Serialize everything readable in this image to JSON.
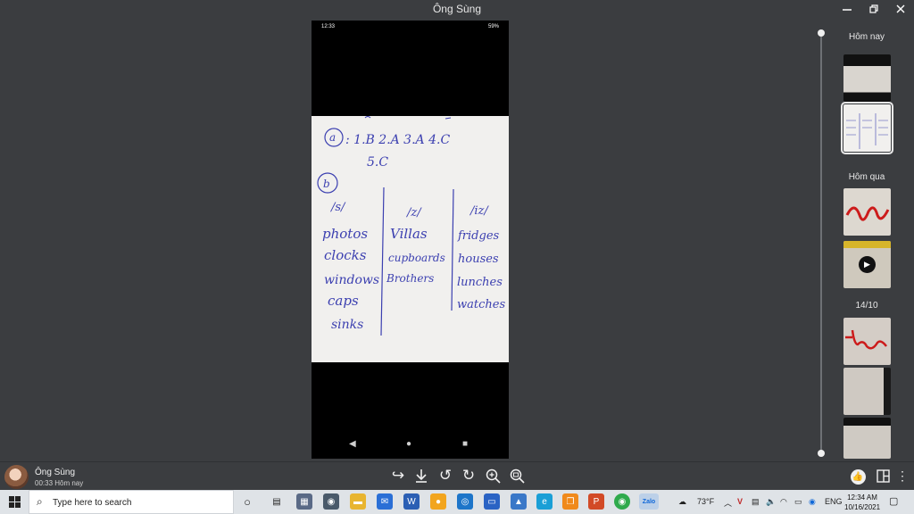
{
  "window": {
    "title": "Ông Sùng"
  },
  "phone": {
    "status_time": "12:33",
    "status_battery": "59%"
  },
  "note": {
    "part_a_marker": "a",
    "part_a_line1": ": 1.B   2.A  3.A  4.C",
    "part_a_line2": "5.C",
    "part_b_marker": "b",
    "columns": [
      {
        "header": "/s/",
        "words": [
          "photos",
          "clocks",
          "windows",
          "caps",
          "sinks"
        ]
      },
      {
        "header": "/z/",
        "words": [
          "Villas",
          "cupboards",
          "Brothers"
        ]
      },
      {
        "header": "/iz/",
        "words": [
          "fridges",
          "houses",
          "lunches",
          "watches"
        ]
      }
    ]
  },
  "timeline": {
    "groups": [
      {
        "label": "Hôm nay"
      },
      {
        "label": "Hôm qua"
      },
      {
        "label": "14/10"
      }
    ]
  },
  "footer": {
    "sender": "Ông Sùng",
    "time": "00:33 Hôm nay"
  },
  "taskbar": {
    "search_placeholder": "Type here to search",
    "weather": "73°F",
    "lang": "ENG",
    "time": "12:34 AM",
    "date": "10/16/2021"
  },
  "icons": {
    "share": "share-icon",
    "download": "download-icon",
    "rotate_left": "rotate-left-icon",
    "rotate_right": "rotate-right-icon",
    "zoom_in": "zoom-in-icon",
    "zoom_fit": "zoom-fit-icon"
  },
  "colors": {
    "ink": "#3b3fb0",
    "background": "#3b3d40",
    "taskbar": "#dfe3e7"
  }
}
